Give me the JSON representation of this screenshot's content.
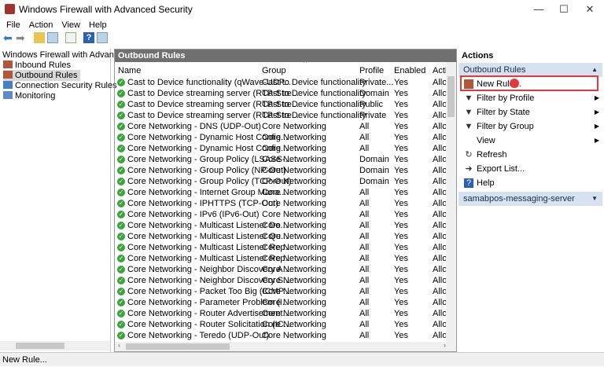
{
  "window": {
    "title": "Windows Firewall with Advanced Security",
    "minimize": "—",
    "maximize": "☐",
    "close": "✕"
  },
  "menu": [
    "File",
    "Action",
    "View",
    "Help"
  ],
  "tree": {
    "root": "Windows Firewall with Advanced Se",
    "items": [
      "Inbound Rules",
      "Outbound Rules",
      "Connection Security Rules",
      "Monitoring"
    ]
  },
  "center": {
    "title": "Outbound Rules",
    "columns": [
      "Name",
      "Group",
      "Profile",
      "Enabled",
      "Acti"
    ],
    "rows": [
      [
        "Cast to Device functionality (qWave-UDP...",
        "Cast to Device functionality",
        "Private...",
        "Yes",
        "Allo"
      ],
      [
        "Cast to Device streaming server (RTP-Stre...",
        "Cast to Device functionality",
        "Domain",
        "Yes",
        "Allo"
      ],
      [
        "Cast to Device streaming server (RTP-Stre...",
        "Cast to Device functionality",
        "Public",
        "Yes",
        "Allo"
      ],
      [
        "Cast to Device streaming server (RTP-Stre...",
        "Cast to Device functionality",
        "Private",
        "Yes",
        "Allo"
      ],
      [
        "Core Networking - DNS (UDP-Out)",
        "Core Networking",
        "All",
        "Yes",
        "Allo"
      ],
      [
        "Core Networking - Dynamic Host Config...",
        "Core Networking",
        "All",
        "Yes",
        "Allo"
      ],
      [
        "Core Networking - Dynamic Host Config...",
        "Core Networking",
        "All",
        "Yes",
        "Allo"
      ],
      [
        "Core Networking - Group Policy (LSASS-...",
        "Core Networking",
        "Domain",
        "Yes",
        "Allo"
      ],
      [
        "Core Networking - Group Policy (NP-Out)",
        "Core Networking",
        "Domain",
        "Yes",
        "Allo"
      ],
      [
        "Core Networking - Group Policy (TCP-Out)",
        "Core Networking",
        "Domain",
        "Yes",
        "Allo"
      ],
      [
        "Core Networking - Internet Group Mana...",
        "Core Networking",
        "All",
        "Yes",
        "Allo"
      ],
      [
        "Core Networking - IPHTTPS (TCP-Out)",
        "Core Networking",
        "All",
        "Yes",
        "Allo"
      ],
      [
        "Core Networking - IPv6 (IPv6-Out)",
        "Core Networking",
        "All",
        "Yes",
        "Allo"
      ],
      [
        "Core Networking - Multicast Listener Do...",
        "Core Networking",
        "All",
        "Yes",
        "Allo"
      ],
      [
        "Core Networking - Multicast Listener Qu...",
        "Core Networking",
        "All",
        "Yes",
        "Allo"
      ],
      [
        "Core Networking - Multicast Listener Rep...",
        "Core Networking",
        "All",
        "Yes",
        "Allo"
      ],
      [
        "Core Networking - Multicast Listener Rep...",
        "Core Networking",
        "All",
        "Yes",
        "Allo"
      ],
      [
        "Core Networking - Neighbor Discovery A...",
        "Core Networking",
        "All",
        "Yes",
        "Allo"
      ],
      [
        "Core Networking - Neighbor Discovery S...",
        "Core Networking",
        "All",
        "Yes",
        "Allo"
      ],
      [
        "Core Networking - Packet Too Big (ICMP...",
        "Core Networking",
        "All",
        "Yes",
        "Allo"
      ],
      [
        "Core Networking - Parameter Problem (I...",
        "Core Networking",
        "All",
        "Yes",
        "Allo"
      ],
      [
        "Core Networking - Router Advertisement...",
        "Core Networking",
        "All",
        "Yes",
        "Allo"
      ],
      [
        "Core Networking - Router Solicitation (IC...",
        "Core Networking",
        "All",
        "Yes",
        "Allo"
      ],
      [
        "Core Networking - Teredo (UDP-Out)",
        "Core Networking",
        "All",
        "Yes",
        "Allo"
      ]
    ]
  },
  "actions": {
    "header": "Actions",
    "section1": "Outbound Rules",
    "items": [
      {
        "label": "New Rule...",
        "icon": "new-rule-icon",
        "submenu": false
      },
      {
        "label": "Filter by Profile",
        "icon": "filter-icon",
        "submenu": true
      },
      {
        "label": "Filter by State",
        "icon": "filter-icon",
        "submenu": true
      },
      {
        "label": "Filter by Group",
        "icon": "filter-icon",
        "submenu": true
      },
      {
        "label": "View",
        "icon": "",
        "submenu": true
      },
      {
        "label": "Refresh",
        "icon": "refresh-icon",
        "submenu": false
      },
      {
        "label": "Export List...",
        "icon": "export-icon",
        "submenu": false
      },
      {
        "label": "Help",
        "icon": "help-icon",
        "submenu": false
      }
    ],
    "section2": "samabpos-messaging-server",
    "highlight_color": "#e0393e"
  },
  "status": "New Rule..."
}
